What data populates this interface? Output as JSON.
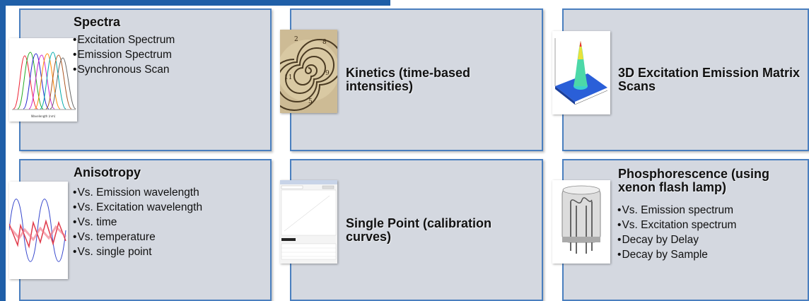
{
  "cards": [
    {
      "title": "Spectra",
      "image": "overlapping-emission-spectra-plot",
      "items": [
        "Excitation Spectrum",
        "Emission Spectrum",
        "Synchronous Scan"
      ]
    },
    {
      "title": "Kinetics (time-based intensities)",
      "image": "spiral-clock-image",
      "items": []
    },
    {
      "title": "3D Excitation Emission Matrix Scans",
      "image": "3d-surface-plot",
      "items": []
    },
    {
      "title": "Anisotropy",
      "image": "sine-wave-plot",
      "items": [
        "Vs. Emission wavelength",
        "Vs. Excitation wavelength",
        "Vs. time",
        "Vs. temperature",
        "Vs. single point"
      ]
    },
    {
      "title": "Single Point (calibration curves)",
      "image": "software-window-screenshot",
      "items": []
    },
    {
      "title": "Phosphorescence (using xenon flash lamp)",
      "image": "xenon-flash-lamp-photo",
      "items": [
        "Vs. Emission spectrum",
        "Vs. Excitation spectrum",
        "Decay by Delay",
        "Decay by Sample"
      ]
    }
  ],
  "colors": {
    "card_bg": "#d4d8e0",
    "card_border": "#4a7fbf",
    "frame": "#1f5fa8"
  }
}
